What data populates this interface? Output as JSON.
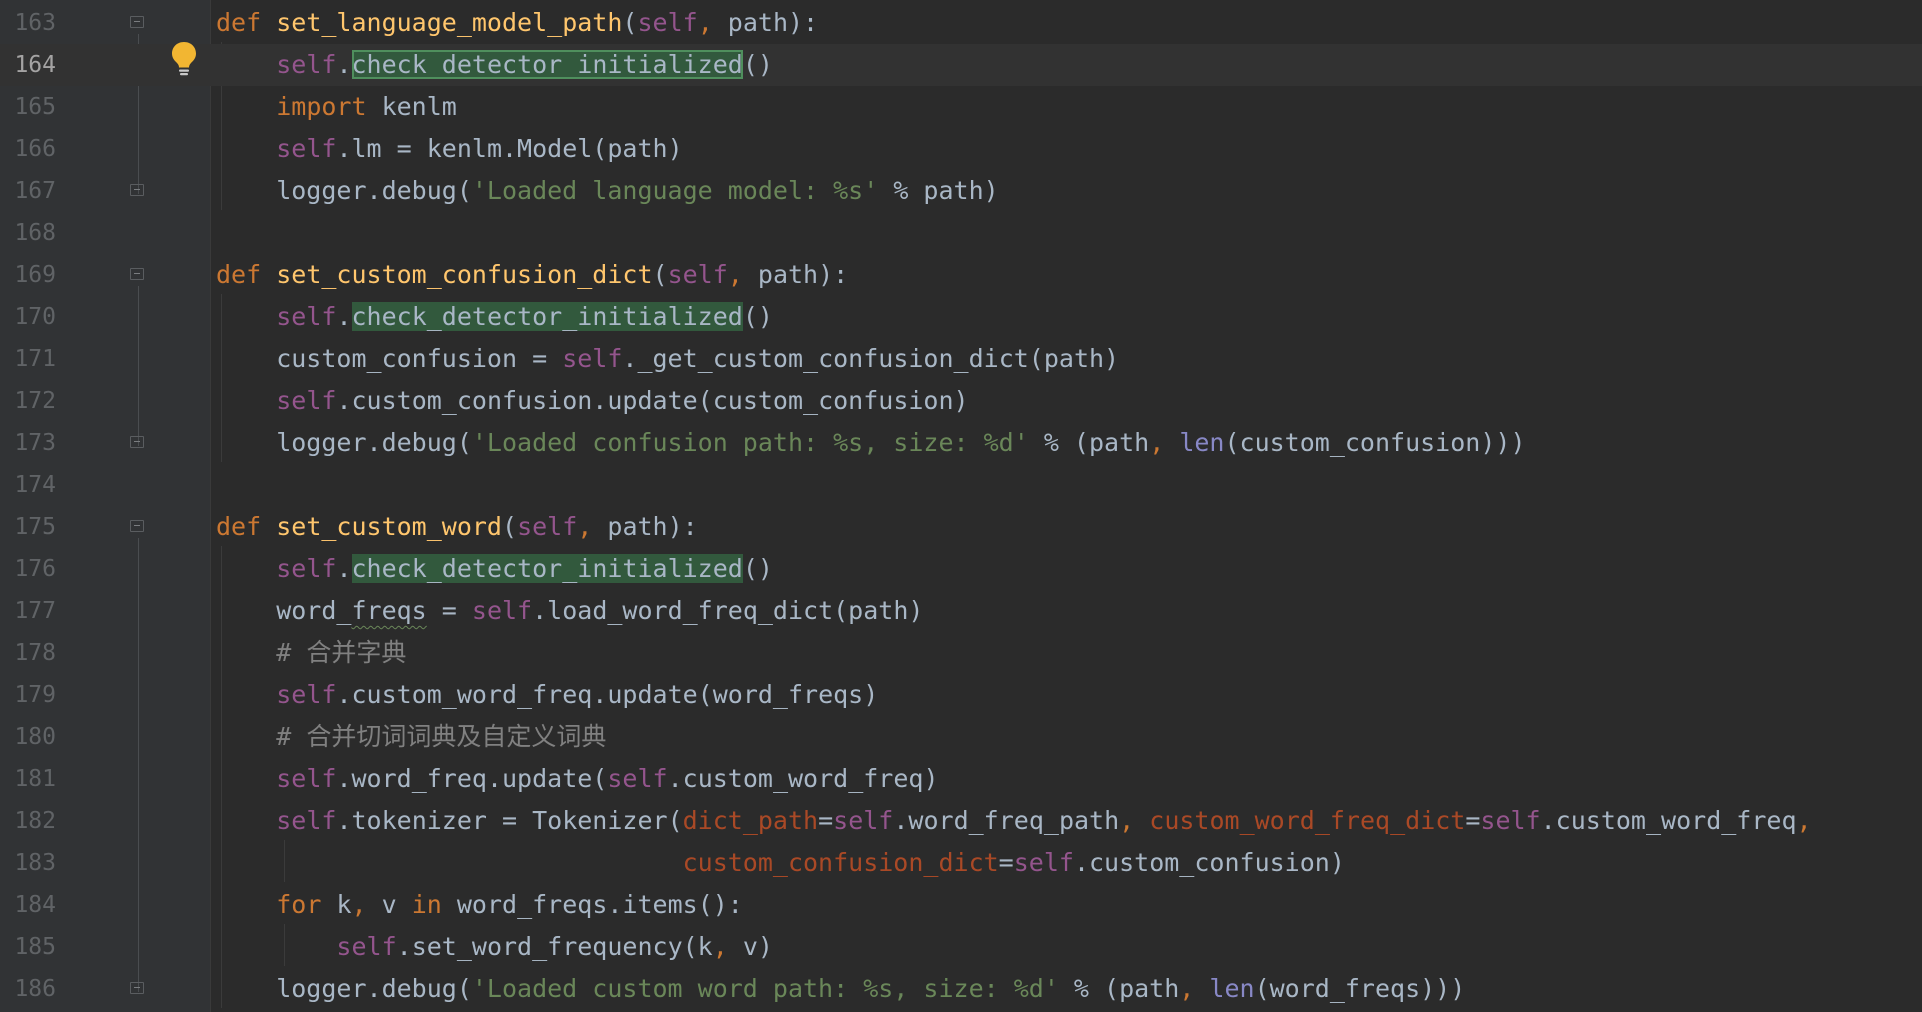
{
  "editor": {
    "current_line": 164,
    "lines": [
      {
        "n": "163",
        "tokens": [
          [
            "kw",
            "def "
          ],
          [
            "fn",
            "set_language_model_path"
          ],
          [
            "plain",
            "("
          ],
          [
            "self",
            "self"
          ],
          [
            "kw",
            ", "
          ],
          [
            "plain",
            "path):"
          ]
        ]
      },
      {
        "n": "164",
        "tokens": [
          [
            "plain",
            "    "
          ],
          [
            "self",
            "self"
          ],
          [
            "plain",
            "."
          ],
          [
            "hlc",
            "check_detector_initialized"
          ],
          [
            "plain",
            "()"
          ]
        ]
      },
      {
        "n": "165",
        "tokens": [
          [
            "plain",
            "    "
          ],
          [
            "kw",
            "import "
          ],
          [
            "plain",
            "kenlm"
          ]
        ]
      },
      {
        "n": "166",
        "tokens": [
          [
            "plain",
            "    "
          ],
          [
            "self",
            "self"
          ],
          [
            "plain",
            ".lm = kenlm.Model(path)"
          ]
        ]
      },
      {
        "n": "167",
        "tokens": [
          [
            "plain",
            "    logger.debug("
          ],
          [
            "str",
            "'Loaded language model: %s'"
          ],
          [
            "plain",
            " % path)"
          ]
        ]
      },
      {
        "n": "168",
        "tokens": []
      },
      {
        "n": "169",
        "tokens": [
          [
            "kw",
            "def "
          ],
          [
            "fn",
            "set_custom_confusion_dict"
          ],
          [
            "plain",
            "("
          ],
          [
            "self",
            "self"
          ],
          [
            "kw",
            ", "
          ],
          [
            "plain",
            "path):"
          ]
        ]
      },
      {
        "n": "170",
        "tokens": [
          [
            "plain",
            "    "
          ],
          [
            "self",
            "self"
          ],
          [
            "plain",
            "."
          ],
          [
            "hl",
            "check_detector_initialized"
          ],
          [
            "plain",
            "()"
          ]
        ]
      },
      {
        "n": "171",
        "tokens": [
          [
            "plain",
            "    custom_confusion = "
          ],
          [
            "self",
            "self"
          ],
          [
            "plain",
            "._get_custom_confusion_dict(path)"
          ]
        ]
      },
      {
        "n": "172",
        "tokens": [
          [
            "plain",
            "    "
          ],
          [
            "self",
            "self"
          ],
          [
            "plain",
            ".custom_confusion.update(custom_confusion)"
          ]
        ]
      },
      {
        "n": "173",
        "tokens": [
          [
            "plain",
            "    logger.debug("
          ],
          [
            "str",
            "'Loaded confusion path: %s, size: %d'"
          ],
          [
            "plain",
            " % (path"
          ],
          [
            "kw",
            ", "
          ],
          [
            "builtin",
            "len"
          ],
          [
            "plain",
            "(custom_confusion)))"
          ]
        ]
      },
      {
        "n": "174",
        "tokens": []
      },
      {
        "n": "175",
        "tokens": [
          [
            "kw",
            "def "
          ],
          [
            "fn",
            "set_custom_word"
          ],
          [
            "plain",
            "("
          ],
          [
            "self",
            "self"
          ],
          [
            "kw",
            ", "
          ],
          [
            "plain",
            "path):"
          ]
        ]
      },
      {
        "n": "176",
        "tokens": [
          [
            "plain",
            "    "
          ],
          [
            "self",
            "self"
          ],
          [
            "plain",
            "."
          ],
          [
            "hl",
            "check_detector_initialized"
          ],
          [
            "plain",
            "()"
          ]
        ]
      },
      {
        "n": "177",
        "tokens": [
          [
            "plain",
            "    word_"
          ],
          [
            "sq",
            "freqs"
          ],
          [
            "plain",
            " = "
          ],
          [
            "self",
            "self"
          ],
          [
            "plain",
            ".load_word_freq_dict(path)"
          ]
        ]
      },
      {
        "n": "178",
        "tokens": [
          [
            "plain",
            "    "
          ],
          [
            "cmt",
            "# 合并字典"
          ]
        ]
      },
      {
        "n": "179",
        "tokens": [
          [
            "plain",
            "    "
          ],
          [
            "self",
            "self"
          ],
          [
            "plain",
            ".custom_word_freq.update(word_freqs)"
          ]
        ]
      },
      {
        "n": "180",
        "tokens": [
          [
            "plain",
            "    "
          ],
          [
            "cmt",
            "# 合并切词词典及自定义词典"
          ]
        ]
      },
      {
        "n": "181",
        "tokens": [
          [
            "plain",
            "    "
          ],
          [
            "self",
            "self"
          ],
          [
            "plain",
            ".word_freq.update("
          ],
          [
            "self",
            "self"
          ],
          [
            "plain",
            ".custom_word_freq)"
          ]
        ]
      },
      {
        "n": "182",
        "tokens": [
          [
            "plain",
            "    "
          ],
          [
            "self",
            "self"
          ],
          [
            "plain",
            ".tokenizer = Tokenizer("
          ],
          [
            "param",
            "dict_path"
          ],
          [
            "plain",
            "="
          ],
          [
            "self",
            "self"
          ],
          [
            "plain",
            ".word_freq_path"
          ],
          [
            "kw",
            ", "
          ],
          [
            "param",
            "custom_word_freq_dict"
          ],
          [
            "plain",
            "="
          ],
          [
            "self",
            "self"
          ],
          [
            "plain",
            ".custom_word_freq"
          ],
          [
            "kw",
            ","
          ]
        ]
      },
      {
        "n": "183",
        "tokens": [
          [
            "plain",
            "                               "
          ],
          [
            "param",
            "custom_confusion_dict"
          ],
          [
            "plain",
            "="
          ],
          [
            "self",
            "self"
          ],
          [
            "plain",
            ".custom_confusion)"
          ]
        ]
      },
      {
        "n": "184",
        "tokens": [
          [
            "plain",
            "    "
          ],
          [
            "kw",
            "for "
          ],
          [
            "plain",
            "k"
          ],
          [
            "kw",
            ", "
          ],
          [
            "plain",
            "v "
          ],
          [
            "kw",
            "in "
          ],
          [
            "plain",
            "word_freqs.items():"
          ]
        ]
      },
      {
        "n": "185",
        "tokens": [
          [
            "plain",
            "        "
          ],
          [
            "self",
            "self"
          ],
          [
            "plain",
            ".set_word_frequency(k"
          ],
          [
            "kw",
            ", "
          ],
          [
            "plain",
            "v)"
          ]
        ]
      },
      {
        "n": "186",
        "tokens": [
          [
            "plain",
            "    logger.debug("
          ],
          [
            "str",
            "'Loaded custom word path: %s, size: %d'"
          ],
          [
            "plain",
            " % (path"
          ],
          [
            "kw",
            ", "
          ],
          [
            "builtin",
            "len"
          ],
          [
            "plain",
            "(word_freqs)))"
          ]
        ]
      }
    ],
    "fold_markers": [
      "163",
      "167",
      "169",
      "173",
      "175",
      "186"
    ],
    "intention_icon": "lightbulb-icon",
    "colors": {
      "background": "#2b2b2b",
      "keyword": "#cc7832",
      "function": "#ffc66d",
      "self": "#94558d",
      "string": "#6a8759",
      "comment": "#808080",
      "param": "#aa4926",
      "builtin": "#8888c6",
      "highlight": "#32593d",
      "bulb": "#f2b632"
    }
  }
}
